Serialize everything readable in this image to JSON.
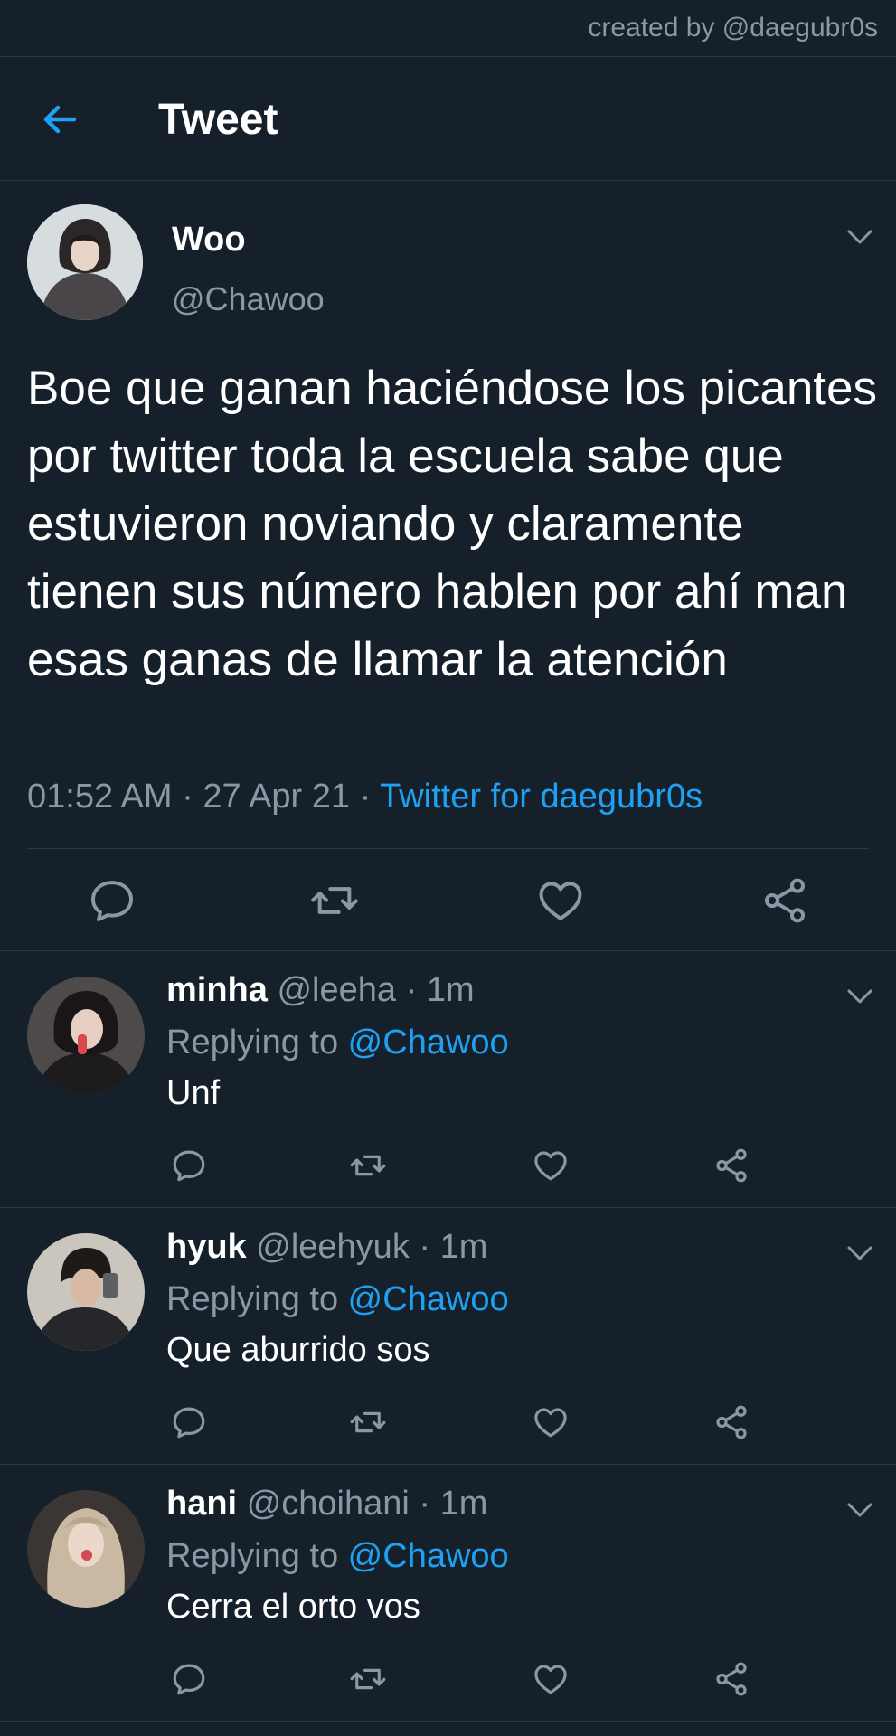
{
  "credit": "created by @daegubr0s",
  "header": {
    "title": "Tweet"
  },
  "tweet": {
    "name": "Woo",
    "handle": "@Chawoo",
    "text": "Boe que ganan haciéndose los picantes por twitter toda la escuela sabe que estuvieron noviando y claramente tienen sus número hablen por ahí man esas ganas de llamar la atención",
    "time": "01:52 AM",
    "date": "27 Apr 21",
    "client": "Twitter for daegubr0s",
    "separator": " · "
  },
  "replying_label": "Replying to ",
  "replies": [
    {
      "name": "minha",
      "handle": "@leeha",
      "time": "1m",
      "reply_to": "@Chawoo",
      "text": "Unf"
    },
    {
      "name": "hyuk",
      "handle": "@leehyuk",
      "time": "1m",
      "reply_to": "@Chawoo",
      "text": "Que aburrido sos"
    },
    {
      "name": "hani",
      "handle": "@choihani",
      "time": "1m",
      "reply_to": "@Chawoo",
      "text": "Cerra el orto vos"
    }
  ],
  "colors": {
    "background": "#15202b",
    "accent": "#1da1f2",
    "secondary_text": "#8899a6",
    "divider": "#2b3845"
  }
}
